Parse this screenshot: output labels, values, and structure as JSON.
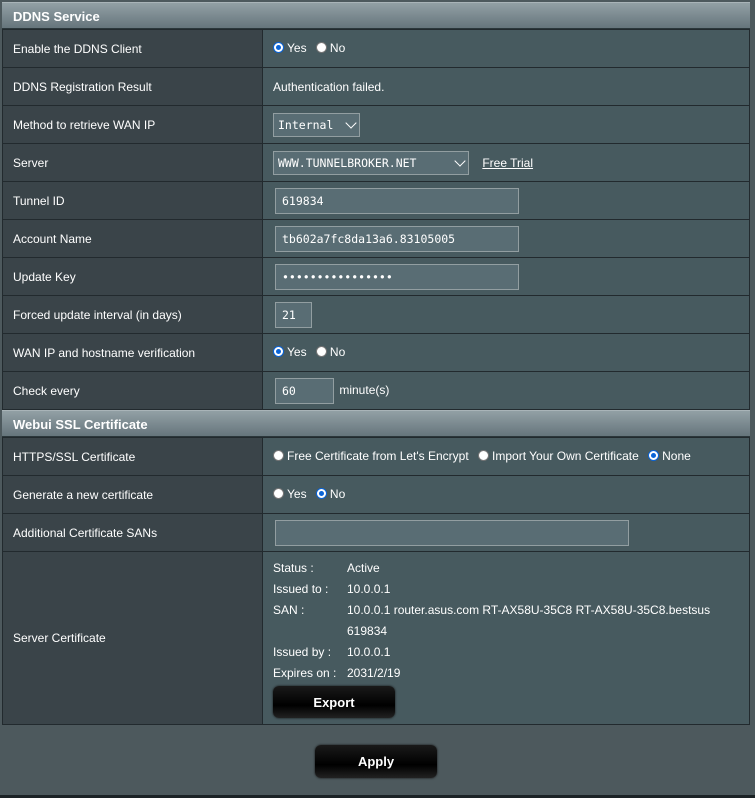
{
  "ddns": {
    "header": "DDNS Service",
    "enable_label": "Enable the DDNS Client",
    "enable_yes": "Yes",
    "enable_no": "No",
    "enable_value": "Yes",
    "registration_label": "DDNS Registration Result",
    "registration_value": "Authentication failed.",
    "method_label": "Method to retrieve WAN IP",
    "method_value": "Internal",
    "server_label": "Server",
    "server_value": "WWW.TUNNELBROKER.NET",
    "free_trial": "Free Trial",
    "tunnel_label": "Tunnel ID",
    "tunnel_value": "619834",
    "account_label": "Account Name",
    "account_value": "tb602a7fc8da13a6.83105005",
    "update_key_label": "Update Key",
    "update_key_value": "••••••••••••••••",
    "forced_label": "Forced update interval (in days)",
    "forced_value": "21",
    "verify_label": "WAN IP and hostname verification",
    "verify_yes": "Yes",
    "verify_no": "No",
    "verify_value": "Yes",
    "check_label": "Check every",
    "check_value": "60",
    "check_unit": "minute(s)"
  },
  "ssl": {
    "header": "Webui SSL Certificate",
    "https_label": "HTTPS/SSL Certificate",
    "opt_free": "Free Certificate from Let's Encrypt",
    "opt_import": "Import Your Own Certificate",
    "opt_none": "None",
    "https_value": "None",
    "generate_label": "Generate a new certificate",
    "generate_yes": "Yes",
    "generate_no": "No",
    "generate_value": "No",
    "sans_label": "Additional Certificate SANs",
    "sans_value": "",
    "server_cert_label": "Server Certificate",
    "cert": {
      "status_k": "Status :",
      "status_v": "Active",
      "issued_to_k": "Issued to :",
      "issued_to_v": "10.0.0.1",
      "san_k": "SAN :",
      "san_v": "10.0.0.1 router.asus.com RT-AX58U-35C8 RT-AX58U-35C8.bestsus 619834",
      "issued_by_k": "Issued by :",
      "issued_by_v": "10.0.0.1",
      "expires_k": "Expires on :",
      "expires_v": "2031/2/19"
    },
    "export_label": "Export"
  },
  "apply_label": "Apply",
  "colors": {
    "background": "#4d595d",
    "label_cell": "#3a4449",
    "value_cell": "#475a5f",
    "radio_selected": "#0a64d8"
  }
}
